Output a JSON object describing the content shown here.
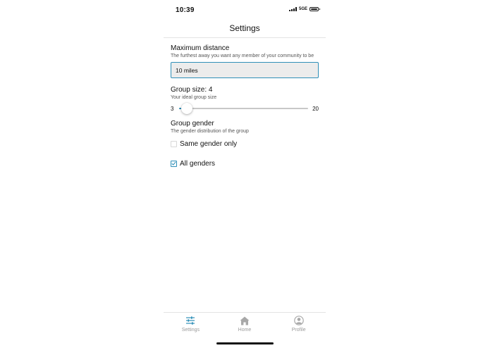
{
  "status_bar": {
    "time": "10:39",
    "network": "5GE"
  },
  "header": {
    "title": "Settings"
  },
  "max_distance": {
    "title": "Maximum distance",
    "subtitle": "The furthest away you want any member of your community to be",
    "value": "10 miles"
  },
  "group_size": {
    "title": "Group size: 4",
    "subtitle": "Your ideal group size",
    "min_label": "3",
    "max_label": "20",
    "min": 3,
    "max": 20,
    "value": 4
  },
  "group_gender": {
    "title": "Group gender",
    "subtitle": "The gender distribution of the group",
    "options": [
      {
        "label": "Same gender only",
        "checked": false
      },
      {
        "label": "All genders",
        "checked": true
      }
    ]
  },
  "tabs": [
    {
      "label": "Settings",
      "icon": "sliders-icon",
      "active": true
    },
    {
      "label": "Home",
      "icon": "home-icon",
      "active": false
    },
    {
      "label": "Profile",
      "icon": "profile-icon",
      "active": false
    }
  ],
  "colors": {
    "accent": "#2f8fb8",
    "inactive": "#9a9a9a"
  }
}
